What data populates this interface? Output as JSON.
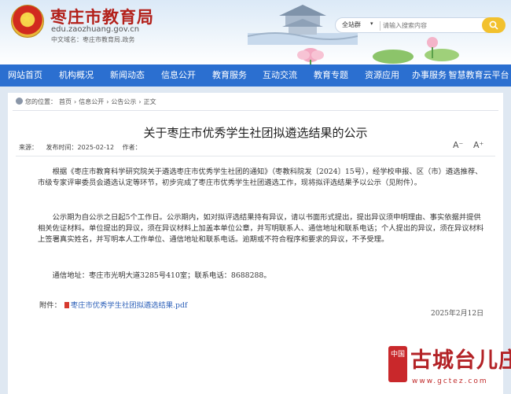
{
  "header": {
    "site_title": "枣庄市教育局",
    "domain": "edu.zaozhuang.gov.cn",
    "cn_domain": "中文域名：枣庄市教育局.政务"
  },
  "search": {
    "scope": "全站群",
    "placeholder": "请输入搜索内容"
  },
  "nav": {
    "items": [
      {
        "label": "网站首页"
      },
      {
        "label": "机构概况"
      },
      {
        "label": "新闻动态"
      },
      {
        "label": "信息公开"
      },
      {
        "label": "教育服务"
      },
      {
        "label": "互动交流"
      },
      {
        "label": "教育专题"
      },
      {
        "label": "资源应用"
      },
      {
        "label": "办事服务"
      },
      {
        "label": "智慧教育云平台"
      }
    ]
  },
  "breadcrumb": {
    "prefix": "您的位置：",
    "items": [
      "首页",
      "信息公开",
      "公告公示",
      "正文"
    ],
    "separator": "›"
  },
  "article": {
    "title": "关于枣庄市优秀学生社团拟遴选结果的公示",
    "source_label": "来源：",
    "date_label": "发布时间：2025-02-12",
    "author_label": "作者：",
    "font_decrease": "A⁻",
    "font_increase": "A⁺",
    "paragraph_1": "根据《枣庄市教育科学研究院关于遴选枣庄市优秀学生社团的通知》（枣教科院发〔2024〕15号），经学校申报、区（市）遴选推荐、市级专家评审委员会遴选认定等环节，初步完成了枣庄市优秀学生社团遴选工作，现将拟评选结果予以公示（见附件）。",
    "paragraph_2": "公示期为自公示之日起5个工作日。公示期内，如对拟评选结果持有异议，请以书面形式提出，提出异议须申明理由、事实依据并提供相关佐证材料。单位提出的异议，须在异议材料上加盖本单位公章，并写明联系人、通信地址和联系电话；个人提出的异议，须在异议材料上签署真实姓名，并写明本人工作单位、通信地址和联系电话。逾期或不符合程序和要求的异议，不予受理。",
    "paragraph_3": "通信地址：枣庄市光明大道3285号410室；联系电话：8688288。",
    "attachment_label": "附件：",
    "attachment_file": "枣庄市优秀学生社团拟遴选结果.pdf",
    "sign_date": "2025年2月12日"
  },
  "watermark": {
    "badge": "中国",
    "title": "古城台儿庄",
    "url": "www.gctez.com"
  },
  "colors": {
    "nav_bg": "#2b6fd0",
    "title_red": "#b3201a",
    "search_button": "#f2c12e"
  }
}
